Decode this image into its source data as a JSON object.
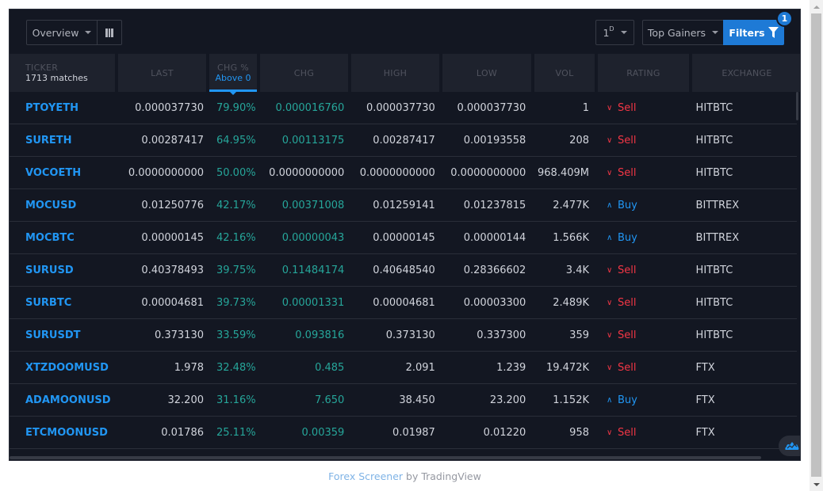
{
  "toolbar": {
    "view_label": "Overview",
    "columns_icon": "columns-icon",
    "interval_label": "1",
    "interval_suffix": "D",
    "preset_label": "Top Gainers",
    "filters_label": "Filters",
    "filters_icon": "funnel-icon",
    "filters_count": "1"
  },
  "columns": [
    {
      "key": "ticker",
      "label": "TICKER",
      "sub": "1713 matches"
    },
    {
      "key": "last",
      "label": "LAST"
    },
    {
      "key": "chg_pct",
      "label": "CHG %",
      "sub": "Above 0",
      "active": true
    },
    {
      "key": "chg",
      "label": "CHG"
    },
    {
      "key": "high",
      "label": "HIGH"
    },
    {
      "key": "low",
      "label": "LOW"
    },
    {
      "key": "vol",
      "label": "VOL"
    },
    {
      "key": "rating",
      "label": "RATING"
    },
    {
      "key": "exchange",
      "label": "EXCHANGE"
    }
  ],
  "rows": [
    {
      "ticker": "PTOYETH",
      "last": "0.000037730",
      "chg_pct": "79.90%",
      "chg": "0.000016760",
      "chg_positive": true,
      "high": "0.000037730",
      "low": "0.000037730",
      "vol": "1",
      "rating": "Sell",
      "exchange": "HITBTC"
    },
    {
      "ticker": "SURETH",
      "last": "0.00287417",
      "chg_pct": "64.95%",
      "chg": "0.00113175",
      "chg_positive": true,
      "high": "0.00287417",
      "low": "0.00193558",
      "vol": "208",
      "rating": "Sell",
      "exchange": "HITBTC"
    },
    {
      "ticker": "VOCOETH",
      "last": "0.0000000000",
      "chg_pct": "50.00%",
      "chg": "0.0000000000",
      "chg_positive": false,
      "high": "0.0000000000",
      "low": "0.0000000000",
      "vol": "968.409M",
      "rating": "Sell",
      "exchange": "HITBTC"
    },
    {
      "ticker": "MOCUSD",
      "last": "0.01250776",
      "chg_pct": "42.17%",
      "chg": "0.00371008",
      "chg_positive": true,
      "high": "0.01259141",
      "low": "0.01237815",
      "vol": "2.477K",
      "rating": "Buy",
      "exchange": "BITTREX"
    },
    {
      "ticker": "MOCBTC",
      "last": "0.00000145",
      "chg_pct": "42.16%",
      "chg": "0.00000043",
      "chg_positive": true,
      "high": "0.00000145",
      "low": "0.00000144",
      "vol": "1.566K",
      "rating": "Buy",
      "exchange": "BITTREX"
    },
    {
      "ticker": "SURUSD",
      "last": "0.40378493",
      "chg_pct": "39.75%",
      "chg": "0.11484174",
      "chg_positive": true,
      "high": "0.40648540",
      "low": "0.28366602",
      "vol": "3.4K",
      "rating": "Sell",
      "exchange": "HITBTC"
    },
    {
      "ticker": "SURBTC",
      "last": "0.00004681",
      "chg_pct": "39.73%",
      "chg": "0.00001331",
      "chg_positive": true,
      "high": "0.00004681",
      "low": "0.00003300",
      "vol": "2.489K",
      "rating": "Sell",
      "exchange": "HITBTC"
    },
    {
      "ticker": "SURUSDT",
      "last": "0.373130",
      "chg_pct": "33.59%",
      "chg": "0.093816",
      "chg_positive": true,
      "high": "0.373130",
      "low": "0.337300",
      "vol": "359",
      "rating": "Sell",
      "exchange": "HITBTC"
    },
    {
      "ticker": "XTZDOOMUSD",
      "last": "1.978",
      "chg_pct": "32.48%",
      "chg": "0.485",
      "chg_positive": true,
      "high": "2.091",
      "low": "1.239",
      "vol": "19.472K",
      "rating": "Sell",
      "exchange": "FTX"
    },
    {
      "ticker": "ADAMOONUSD",
      "last": "32.200",
      "chg_pct": "31.16%",
      "chg": "7.650",
      "chg_positive": true,
      "high": "38.450",
      "low": "23.200",
      "vol": "1.152K",
      "rating": "Buy",
      "exchange": "FTX"
    },
    {
      "ticker": "ETCMOONUSD",
      "last": "0.01786",
      "chg_pct": "25.11%",
      "chg": "0.00359",
      "chg_positive": true,
      "high": "0.01987",
      "low": "0.01220",
      "vol": "958",
      "rating": "Sell",
      "exchange": "FTX"
    }
  ],
  "rating_icons": {
    "Sell": "chevron-down-icon",
    "Buy": "chevron-up-icon"
  },
  "colors": {
    "accent": "#2196f3",
    "filters_button": "#1e7ad6",
    "positive": "#26a69a",
    "sell": "#f23645",
    "buy": "#2196f3",
    "background": "#131722",
    "header_bg": "#1e222d"
  },
  "footer": {
    "link_text": "Forex Screener",
    "by_text": " by TradingView"
  }
}
